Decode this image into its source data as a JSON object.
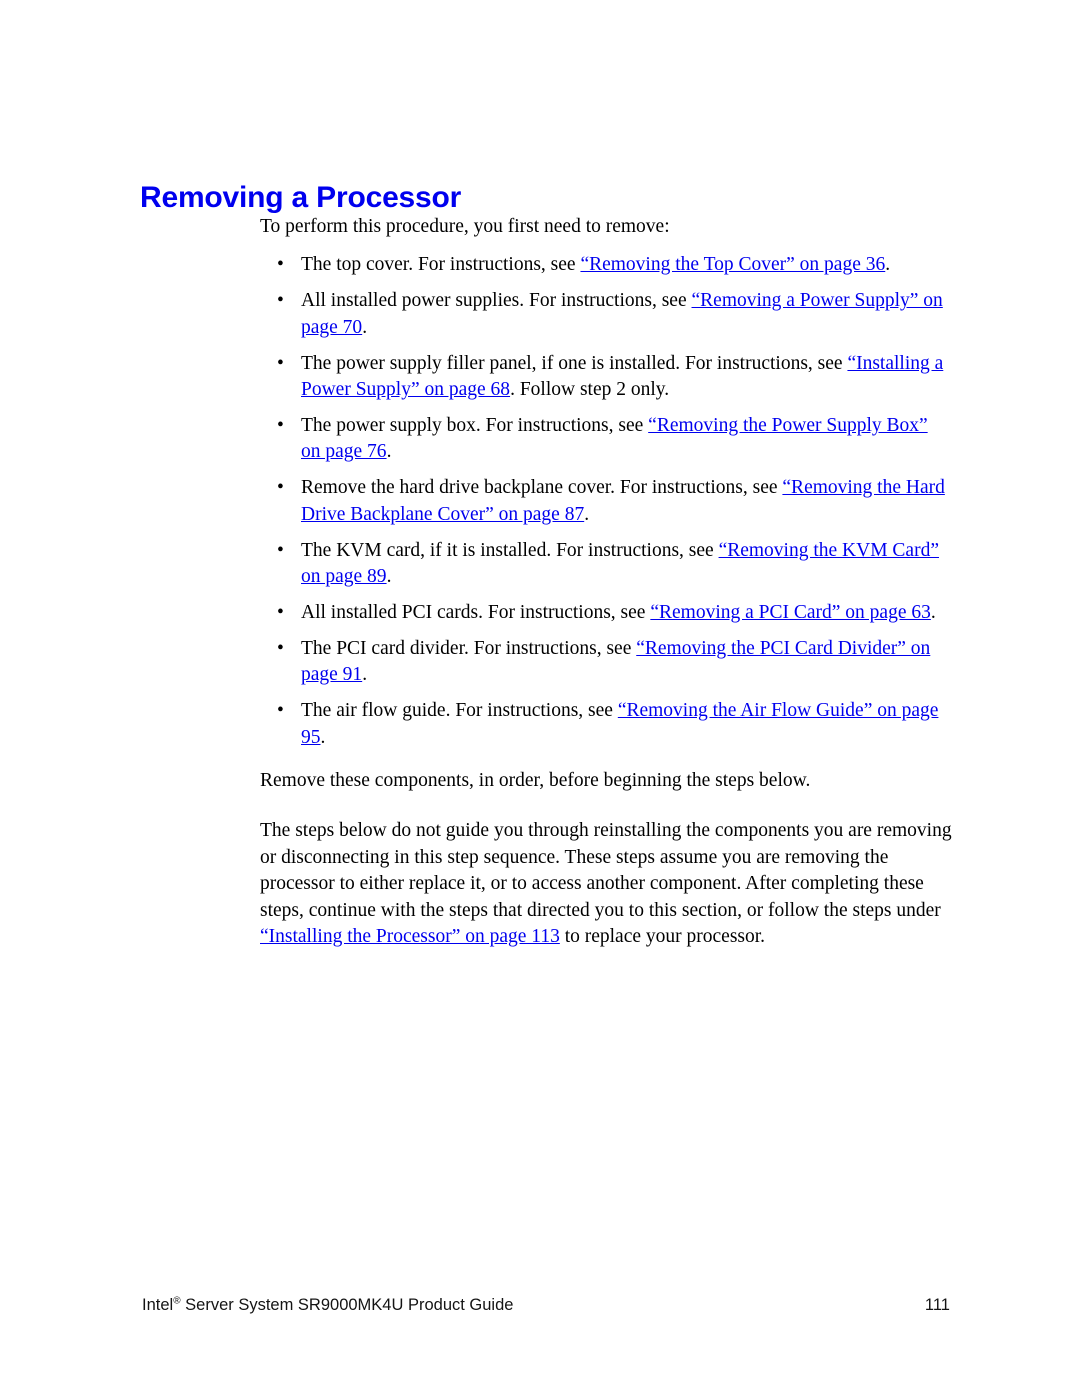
{
  "heading": "Removing a Processor",
  "intro": "To perform this procedure, you first need to remove:",
  "bullets": [
    {
      "bullet_glyph": "•",
      "lead": "The top cover. For instructions, see ",
      "link": "“Removing the Top Cover” on page 36",
      "tail": "."
    },
    {
      "bullet_glyph": "•",
      "lead": "All installed power supplies. For instructions, see ",
      "link": "“Removing a Power Supply” on page 70",
      "tail": "."
    },
    {
      "bullet_glyph": "•",
      "lead": "The power supply filler panel, if one is installed. For instructions, see ",
      "link": "“Installing a Power Supply” on page 68",
      "tail": ". Follow step 2 only."
    },
    {
      "bullet_glyph": "•",
      "lead": "The power supply box. For instructions, see ",
      "link": "“Removing the Power Supply Box” on page 76",
      "tail": "."
    },
    {
      "bullet_glyph": "•",
      "lead": "Remove the hard drive backplane cover. For instructions, see ",
      "link": "“Removing the Hard Drive Backplane Cover” on page 87",
      "tail": "."
    },
    {
      "bullet_glyph": "•",
      "lead": "The KVM card, if it is installed. For instructions, see ",
      "link": "“Removing the KVM Card” on page 89",
      "tail": "."
    },
    {
      "bullet_glyph": "•",
      "lead": "All installed PCI cards. For instructions, see ",
      "link": "“Removing a PCI Card” on page 63",
      "tail": "."
    },
    {
      "bullet_glyph": "•",
      "lead": "The PCI card divider. For instructions, see ",
      "link": "“Removing the PCI Card Divider” on page 91",
      "tail": "."
    },
    {
      "bullet_glyph": "•",
      "lead": "The air flow guide. For instructions, see ",
      "link": "“Removing the Air Flow Guide” on page 95",
      "tail": "."
    }
  ],
  "after_list_para": "Remove these components, in order, before beginning the steps below.",
  "closing_para": {
    "lead": "The steps below do not guide you through reinstalling the components you are removing or disconnecting in this step sequence. These steps assume you are removing the processor to either replace it, or to access another component. After completing these steps, continue with the steps that directed you to this section, or follow the steps under ",
    "link": "“Installing the Processor” on page 113",
    "tail": " to replace your processor."
  },
  "footer": {
    "brand": "Intel",
    "registered_mark": "®",
    "title": " Server System SR9000MK4U Product Guide",
    "page_number": "111"
  },
  "colors": {
    "link": "#0000ee",
    "heading": "#0000ee",
    "body": "#000000",
    "page_background": "#ffffff"
  }
}
